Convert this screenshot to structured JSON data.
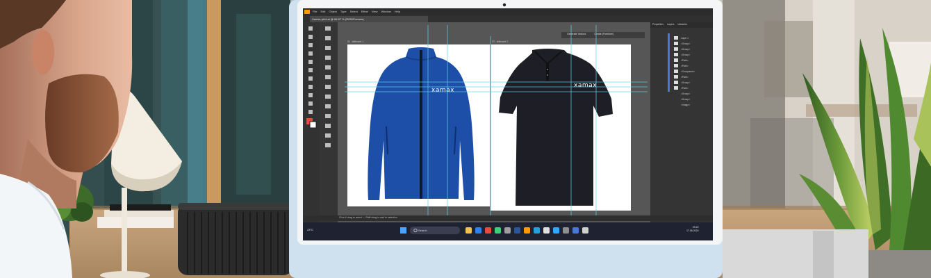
{
  "screen": {
    "app": "Illustrator",
    "menu_items": [
      "File",
      "Edit",
      "Object",
      "Type",
      "Select",
      "Effect",
      "View",
      "Window",
      "Help"
    ],
    "document_tab": "Xamax-print.ai @ 66.67 % (RGB/Preview)",
    "artboards": [
      "01 - Artboard 1",
      "02 - Artboard 2"
    ],
    "context_buttons": [
      "Generate Vectors",
      "Create (Freeform)"
    ],
    "panel_tabs": [
      "Properties",
      "Layers",
      "Libraries"
    ],
    "layer_rows": [
      "Layer 1",
      "<Group>",
      "<Group>",
      "<Group>",
      "<Path>",
      "<Path>",
      "<Compound>",
      "<Path>",
      "<Group>",
      "<Path>",
      "<Group>",
      "<Group>",
      "<Image>"
    ],
    "status_hint": "Click & drag to select — Shift+drag to add to selection",
    "taskbar_search": "Search",
    "weather": "23°C",
    "clock_time": "09:42",
    "clock_date": "17.06.2024"
  },
  "artwork": {
    "jacket_brand": "xamax",
    "polo_brand": "xamax",
    "jacket_color": "#1d4fa8",
    "polo_color": "#1e1f26"
  },
  "colors": {
    "monitor_body": "#cfe0ee",
    "monitor_bezel": "#f4f5f6",
    "app_dark": "#3a3a3a",
    "guide_cyan": "#5fd3e8"
  }
}
